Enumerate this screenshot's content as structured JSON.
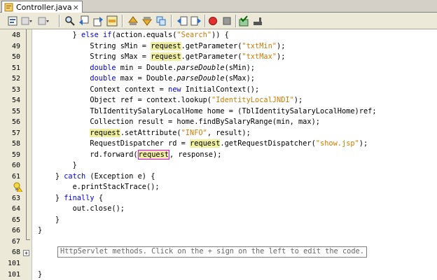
{
  "tab": {
    "title": "Controller.java",
    "close_glyph": "×"
  },
  "toolbar": {
    "icons": [
      "history-icon",
      "back-dropdown-icon",
      "forward-dropdown-icon",
      "find-icon",
      "find-prev-icon",
      "find-next-icon",
      "toggle-highlight-icon",
      "prev-bookmark-icon",
      "next-bookmark-icon",
      "toggle-bookmark-icon",
      "shift-left-icon",
      "shift-right-icon",
      "start-macro-icon",
      "stop-macro-icon",
      "check-icon",
      "uncomment-icon"
    ]
  },
  "colors": {
    "keyword": "#0000e6",
    "string": "#ce7b00",
    "highlight": "#f0f0a0",
    "gutter": "#ece9d8"
  },
  "lines": [
    {
      "num": "48",
      "indent": "        ",
      "parts": [
        [
          "} ",
          ""
        ],
        [
          "else",
          "kw"
        ],
        [
          " ",
          ""
        ],
        [
          "if",
          "kw"
        ],
        [
          "(action.equals(",
          ""
        ],
        [
          "\"Search\"",
          "str"
        ],
        [
          ")) {",
          ""
        ]
      ]
    },
    {
      "num": "49",
      "indent": "            ",
      "parts": [
        [
          "String sMin = ",
          ""
        ],
        [
          "request",
          "hl"
        ],
        [
          ".getParameter(",
          ""
        ],
        [
          "\"txtMin\"",
          "str"
        ],
        [
          ");",
          ""
        ]
      ]
    },
    {
      "num": "50",
      "indent": "            ",
      "parts": [
        [
          "String sMax = ",
          ""
        ],
        [
          "request",
          "hl"
        ],
        [
          ".getParameter(",
          ""
        ],
        [
          "\"txtMax\"",
          "str"
        ],
        [
          ");",
          ""
        ]
      ]
    },
    {
      "num": "51",
      "indent": "            ",
      "parts": [
        [
          "double",
          "kw"
        ],
        [
          " min = Double.",
          ""
        ],
        [
          "parseDouble",
          "it"
        ],
        [
          "(sMin);",
          ""
        ]
      ]
    },
    {
      "num": "52",
      "indent": "            ",
      "parts": [
        [
          "double",
          "kw"
        ],
        [
          " max = Double.",
          ""
        ],
        [
          "parseDouble",
          "it"
        ],
        [
          "(sMax);",
          ""
        ]
      ]
    },
    {
      "num": "53",
      "indent": "            ",
      "parts": [
        [
          "Context context = ",
          ""
        ],
        [
          "new",
          "kw"
        ],
        [
          " InitialContext();",
          ""
        ]
      ]
    },
    {
      "num": "54",
      "indent": "            ",
      "parts": [
        [
          "Object ref = context.lookup(",
          ""
        ],
        [
          "\"IdentityLocalJNDI\"",
          "str"
        ],
        [
          ");",
          ""
        ]
      ]
    },
    {
      "num": "55",
      "indent": "            ",
      "parts": [
        [
          "TblIdentitySalaryLocalHome home = (TblIdentitySalaryLocalHome)ref;",
          ""
        ]
      ]
    },
    {
      "num": "56",
      "indent": "            ",
      "parts": [
        [
          "Collection result = home.findBySalaryRange(min, max);",
          ""
        ]
      ]
    },
    {
      "num": "57",
      "indent": "            ",
      "parts": [
        [
          "request",
          "hl"
        ],
        [
          ".setAttribute(",
          ""
        ],
        [
          "\"INFO\"",
          "str"
        ],
        [
          ", result);",
          ""
        ]
      ]
    },
    {
      "num": "58",
      "indent": "            ",
      "parts": [
        [
          "RequestDispatcher rd = ",
          ""
        ],
        [
          "request",
          "hl"
        ],
        [
          ".getRequestDispatcher(",
          ""
        ],
        [
          "\"show.jsp\"",
          "str"
        ],
        [
          ");",
          ""
        ]
      ]
    },
    {
      "num": "59",
      "indent": "            ",
      "parts": [
        [
          "rd.forward(",
          ""
        ],
        [
          "request",
          "caret"
        ],
        [
          ", response);",
          ""
        ]
      ]
    },
    {
      "num": "60",
      "indent": "        ",
      "parts": [
        [
          "}",
          ""
        ]
      ]
    },
    {
      "num": "61",
      "indent": "    ",
      "parts": [
        [
          "} ",
          ""
        ],
        [
          "catch",
          "kw"
        ],
        [
          " (Exception e) {",
          ""
        ]
      ]
    },
    {
      "num": "",
      "indent": "        ",
      "parts": [
        [
          "e.printStackTrace();",
          ""
        ]
      ]
    },
    {
      "num": "63",
      "indent": "    ",
      "parts": [
        [
          "} ",
          ""
        ],
        [
          "finally",
          "kw"
        ],
        [
          " {",
          ""
        ]
      ]
    },
    {
      "num": "64",
      "indent": "        ",
      "parts": [
        [
          "out.close();",
          ""
        ]
      ]
    },
    {
      "num": "65",
      "indent": "    ",
      "parts": [
        [
          "}",
          ""
        ]
      ]
    },
    {
      "num": "66",
      "indent": "}",
      "parts": [
        [
          "",
          ""
        ]
      ]
    },
    {
      "num": "67",
      "indent": "",
      "parts": [
        [
          "",
          ""
        ]
      ]
    },
    {
      "num": "68",
      "indent": "",
      "parts": [
        [
          "",
          ""
        ]
      ]
    },
    {
      "num": "101",
      "indent": "",
      "parts": [
        [
          "",
          ""
        ]
      ]
    },
    {
      "num": "101",
      "indent": "}",
      "parts": [
        [
          "",
          ""
        ]
      ]
    }
  ],
  "collapsed_text": "HttpServlet methods. Click on the + sign on the left to edit the code.",
  "fold_plus": "+"
}
